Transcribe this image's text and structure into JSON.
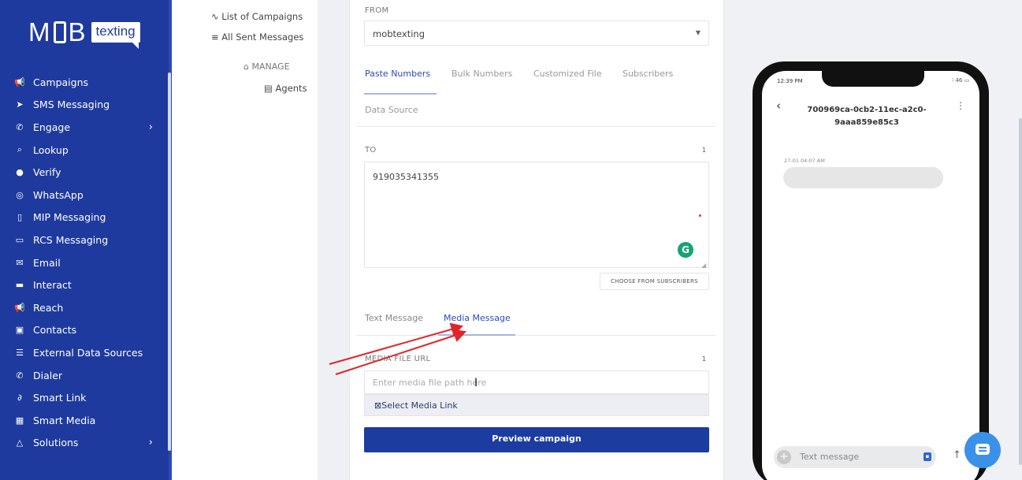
{
  "brand": {
    "name_left": "M",
    "name_right": "B",
    "tag": "texting"
  },
  "sidebar": {
    "items": [
      {
        "label": "Campaigns",
        "icon": "megaphone-icon",
        "glyph": "📢"
      },
      {
        "label": "SMS Messaging",
        "icon": "send-icon",
        "glyph": "➤"
      },
      {
        "label": "Engage",
        "icon": "phone-icon",
        "glyph": "✆",
        "chevron": "›"
      },
      {
        "label": "Lookup",
        "icon": "search-icon",
        "glyph": "⌕"
      },
      {
        "label": "Verify",
        "icon": "shield-icon",
        "glyph": "●"
      },
      {
        "label": "WhatsApp",
        "icon": "whatsapp-icon",
        "glyph": "◎"
      },
      {
        "label": "MIP Messaging",
        "icon": "mobile-icon",
        "glyph": "▯"
      },
      {
        "label": "RCS Messaging",
        "icon": "chat-icon",
        "glyph": "▭"
      },
      {
        "label": "Email",
        "icon": "email-icon",
        "glyph": "✉"
      },
      {
        "label": "Interact",
        "icon": "ticket-icon",
        "glyph": "▬"
      },
      {
        "label": "Reach",
        "icon": "megaphone-icon",
        "glyph": "📢"
      },
      {
        "label": "Contacts",
        "icon": "contacts-icon",
        "glyph": "▣"
      },
      {
        "label": "External Data Sources",
        "icon": "database-icon",
        "glyph": "☰"
      },
      {
        "label": "Dialer",
        "icon": "phone-icon",
        "glyph": "✆"
      },
      {
        "label": "Smart Link",
        "icon": "link-icon",
        "glyph": "∂"
      },
      {
        "label": "Smart Media",
        "icon": "image-icon",
        "glyph": "▦"
      },
      {
        "label": "Solutions",
        "icon": "warning-icon",
        "glyph": "△",
        "chevron": "›"
      }
    ]
  },
  "submenu": {
    "list_campaigns": "∿ List of Campaigns",
    "all_sent": "≡ All Sent Messages",
    "manage": "MANAGE",
    "agents": "Agents"
  },
  "form": {
    "from_label": "FROM",
    "from_value": "mobtexting",
    "tabs": [
      "Paste Numbers",
      "Bulk Numbers",
      "Customized File",
      "Subscribers",
      "Data Source"
    ],
    "to_label": "TO",
    "to_count": "1",
    "to_value": "919035341355",
    "choose_btn": "CHOOSE FROM SUBSCRIBERS",
    "message_tabs": [
      "Text Message",
      "Media Message"
    ],
    "media_label": "MEDIA FILE URL",
    "media_count": "1",
    "media_placeholder": "Enter media file path here",
    "select_media": "Select Media Link",
    "preview_btn": "Preview campaign"
  },
  "phone": {
    "time": "12:39 PM",
    "status": "⁝ 46 ▭",
    "conversation_id": "700969ca-0cb2-11ec-a2c0-9aaa859e85c3",
    "message_timestamp": "27-01 04:07 AM",
    "compose_placeholder": "Text message"
  },
  "colors": {
    "sidebar": "#1f3a9e",
    "accent": "#2a4bb5",
    "button": "#1c3c9f",
    "annotation_arrow": "#e0252b"
  }
}
